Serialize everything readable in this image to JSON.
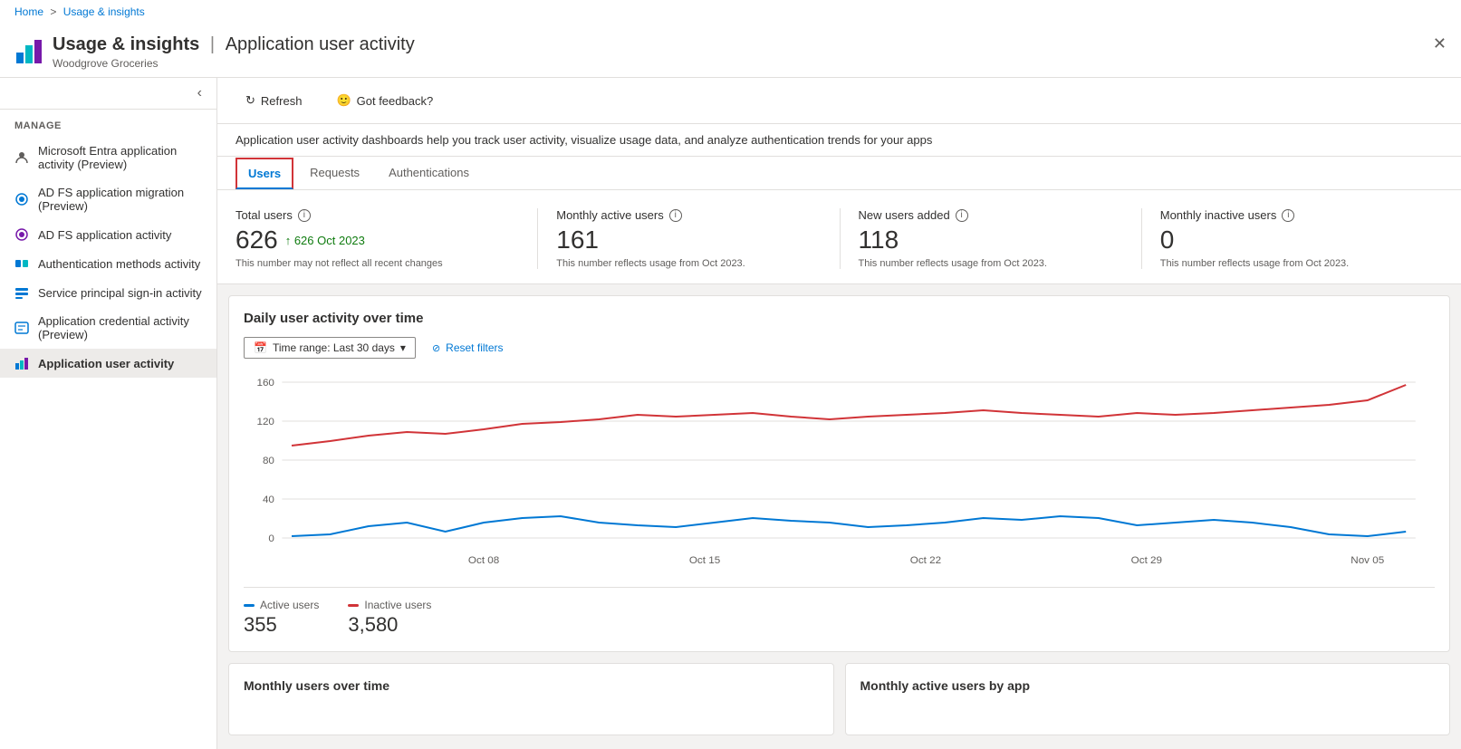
{
  "breadcrumb": {
    "home": "Home",
    "separator": ">",
    "current": "Usage & insights"
  },
  "header": {
    "title": "Usage & insights",
    "separator": "|",
    "subtitle": "Application user activity",
    "org": "Woodgrove Groceries"
  },
  "toolbar": {
    "refresh_label": "Refresh",
    "feedback_label": "Got feedback?"
  },
  "description": "Application user activity dashboards help you track user activity, visualize usage data, and analyze authentication trends for your apps",
  "tabs": [
    {
      "label": "Users",
      "active": true
    },
    {
      "label": "Requests",
      "active": false
    },
    {
      "label": "Authentications",
      "active": false
    }
  ],
  "stats": [
    {
      "label": "Total users",
      "value": "626",
      "change": "↑ 626 Oct 2023",
      "note": "This number may not reflect all recent changes"
    },
    {
      "label": "Monthly active users",
      "value": "161",
      "change": "",
      "note": "This number reflects usage from Oct 2023."
    },
    {
      "label": "New users added",
      "value": "118",
      "change": "",
      "note": "This number reflects usage from Oct 2023."
    },
    {
      "label": "Monthly inactive users",
      "value": "0",
      "change": "",
      "note": "This number reflects usage from Oct 2023."
    }
  ],
  "chart": {
    "title": "Daily user activity over time",
    "time_range_label": "Time range: Last 30 days",
    "reset_filters_label": "Reset filters",
    "x_labels": [
      "Oct 08",
      "Oct 15",
      "Oct 22",
      "Oct 29",
      "Nov 05"
    ],
    "y_labels": [
      "160",
      "120",
      "80",
      "40",
      "0"
    ],
    "active_line_color": "#0078d4",
    "inactive_line_color": "#d13438",
    "legend": [
      {
        "label": "Active users",
        "value": "355",
        "color": "#0078d4"
      },
      {
        "label": "Inactive users",
        "value": "3,580",
        "color": "#d13438"
      }
    ]
  },
  "bottom_sections": [
    {
      "title": "Monthly users over time"
    },
    {
      "title": "Monthly active users by app"
    }
  ],
  "sidebar": {
    "manage_label": "Manage",
    "items": [
      {
        "label": "Microsoft Entra application activity (Preview)",
        "icon": "user-icon",
        "active": false
      },
      {
        "label": "AD FS application migration (Preview)",
        "icon": "adfs-icon",
        "active": false
      },
      {
        "label": "AD FS application activity",
        "icon": "adfs2-icon",
        "active": false
      },
      {
        "label": "Authentication methods activity",
        "icon": "auth-icon",
        "active": false
      },
      {
        "label": "Service principal sign-in activity",
        "icon": "service-icon",
        "active": false
      },
      {
        "label": "Application credential activity (Preview)",
        "icon": "cred-icon",
        "active": false
      },
      {
        "label": "Application user activity",
        "icon": "app-icon",
        "active": true
      }
    ]
  }
}
